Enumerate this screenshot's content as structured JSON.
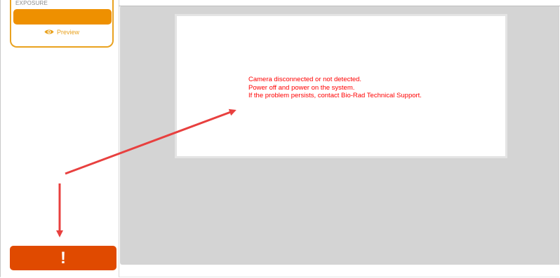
{
  "sidebar": {
    "exposure": {
      "label": "EXPOSURE",
      "preview_label": "Preview",
      "preview_icon": "eye-icon"
    },
    "alert_button": {
      "label": "!",
      "icon": "exclamation"
    }
  },
  "viewer": {
    "error_lines": [
      "Camera disconnected or not detected.",
      "Power off and power on the system.",
      "If the problem persists, contact Bio-Rad Technical Support."
    ]
  },
  "colors": {
    "exposure_accent": "#ee9000",
    "alert": "#e04a00",
    "error_text": "#ff0000",
    "annotation_arrow": "#e8403f",
    "viewer_bg": "#d4d4d4"
  }
}
